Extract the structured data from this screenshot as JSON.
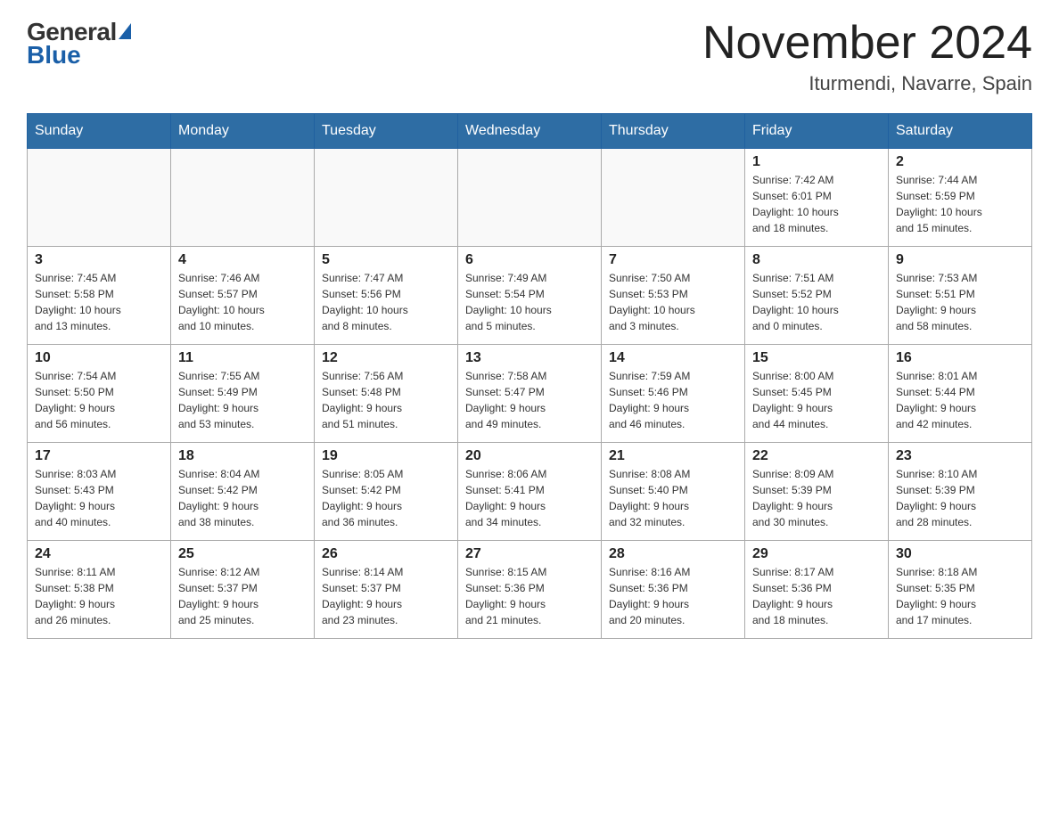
{
  "header": {
    "logo_general": "General",
    "logo_blue": "Blue",
    "month_title": "November 2024",
    "location": "Iturmendi, Navarre, Spain"
  },
  "days_of_week": [
    "Sunday",
    "Monday",
    "Tuesday",
    "Wednesday",
    "Thursday",
    "Friday",
    "Saturday"
  ],
  "weeks": [
    [
      {
        "day": "",
        "info": ""
      },
      {
        "day": "",
        "info": ""
      },
      {
        "day": "",
        "info": ""
      },
      {
        "day": "",
        "info": ""
      },
      {
        "day": "",
        "info": ""
      },
      {
        "day": "1",
        "info": "Sunrise: 7:42 AM\nSunset: 6:01 PM\nDaylight: 10 hours\nand 18 minutes."
      },
      {
        "day": "2",
        "info": "Sunrise: 7:44 AM\nSunset: 5:59 PM\nDaylight: 10 hours\nand 15 minutes."
      }
    ],
    [
      {
        "day": "3",
        "info": "Sunrise: 7:45 AM\nSunset: 5:58 PM\nDaylight: 10 hours\nand 13 minutes."
      },
      {
        "day": "4",
        "info": "Sunrise: 7:46 AM\nSunset: 5:57 PM\nDaylight: 10 hours\nand 10 minutes."
      },
      {
        "day": "5",
        "info": "Sunrise: 7:47 AM\nSunset: 5:56 PM\nDaylight: 10 hours\nand 8 minutes."
      },
      {
        "day": "6",
        "info": "Sunrise: 7:49 AM\nSunset: 5:54 PM\nDaylight: 10 hours\nand 5 minutes."
      },
      {
        "day": "7",
        "info": "Sunrise: 7:50 AM\nSunset: 5:53 PM\nDaylight: 10 hours\nand 3 minutes."
      },
      {
        "day": "8",
        "info": "Sunrise: 7:51 AM\nSunset: 5:52 PM\nDaylight: 10 hours\nand 0 minutes."
      },
      {
        "day": "9",
        "info": "Sunrise: 7:53 AM\nSunset: 5:51 PM\nDaylight: 9 hours\nand 58 minutes."
      }
    ],
    [
      {
        "day": "10",
        "info": "Sunrise: 7:54 AM\nSunset: 5:50 PM\nDaylight: 9 hours\nand 56 minutes."
      },
      {
        "day": "11",
        "info": "Sunrise: 7:55 AM\nSunset: 5:49 PM\nDaylight: 9 hours\nand 53 minutes."
      },
      {
        "day": "12",
        "info": "Sunrise: 7:56 AM\nSunset: 5:48 PM\nDaylight: 9 hours\nand 51 minutes."
      },
      {
        "day": "13",
        "info": "Sunrise: 7:58 AM\nSunset: 5:47 PM\nDaylight: 9 hours\nand 49 minutes."
      },
      {
        "day": "14",
        "info": "Sunrise: 7:59 AM\nSunset: 5:46 PM\nDaylight: 9 hours\nand 46 minutes."
      },
      {
        "day": "15",
        "info": "Sunrise: 8:00 AM\nSunset: 5:45 PM\nDaylight: 9 hours\nand 44 minutes."
      },
      {
        "day": "16",
        "info": "Sunrise: 8:01 AM\nSunset: 5:44 PM\nDaylight: 9 hours\nand 42 minutes."
      }
    ],
    [
      {
        "day": "17",
        "info": "Sunrise: 8:03 AM\nSunset: 5:43 PM\nDaylight: 9 hours\nand 40 minutes."
      },
      {
        "day": "18",
        "info": "Sunrise: 8:04 AM\nSunset: 5:42 PM\nDaylight: 9 hours\nand 38 minutes."
      },
      {
        "day": "19",
        "info": "Sunrise: 8:05 AM\nSunset: 5:42 PM\nDaylight: 9 hours\nand 36 minutes."
      },
      {
        "day": "20",
        "info": "Sunrise: 8:06 AM\nSunset: 5:41 PM\nDaylight: 9 hours\nand 34 minutes."
      },
      {
        "day": "21",
        "info": "Sunrise: 8:08 AM\nSunset: 5:40 PM\nDaylight: 9 hours\nand 32 minutes."
      },
      {
        "day": "22",
        "info": "Sunrise: 8:09 AM\nSunset: 5:39 PM\nDaylight: 9 hours\nand 30 minutes."
      },
      {
        "day": "23",
        "info": "Sunrise: 8:10 AM\nSunset: 5:39 PM\nDaylight: 9 hours\nand 28 minutes."
      }
    ],
    [
      {
        "day": "24",
        "info": "Sunrise: 8:11 AM\nSunset: 5:38 PM\nDaylight: 9 hours\nand 26 minutes."
      },
      {
        "day": "25",
        "info": "Sunrise: 8:12 AM\nSunset: 5:37 PM\nDaylight: 9 hours\nand 25 minutes."
      },
      {
        "day": "26",
        "info": "Sunrise: 8:14 AM\nSunset: 5:37 PM\nDaylight: 9 hours\nand 23 minutes."
      },
      {
        "day": "27",
        "info": "Sunrise: 8:15 AM\nSunset: 5:36 PM\nDaylight: 9 hours\nand 21 minutes."
      },
      {
        "day": "28",
        "info": "Sunrise: 8:16 AM\nSunset: 5:36 PM\nDaylight: 9 hours\nand 20 minutes."
      },
      {
        "day": "29",
        "info": "Sunrise: 8:17 AM\nSunset: 5:36 PM\nDaylight: 9 hours\nand 18 minutes."
      },
      {
        "day": "30",
        "info": "Sunrise: 8:18 AM\nSunset: 5:35 PM\nDaylight: 9 hours\nand 17 minutes."
      }
    ]
  ]
}
